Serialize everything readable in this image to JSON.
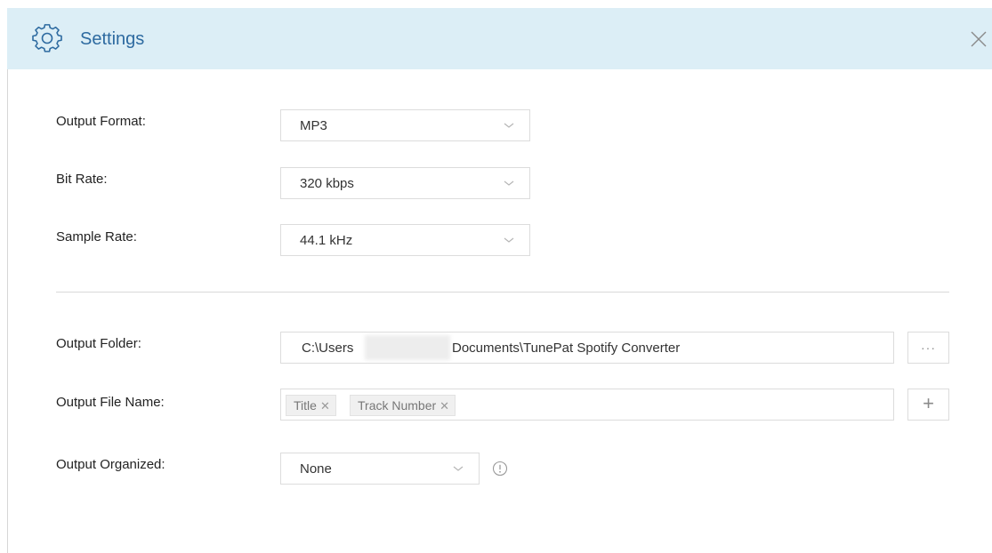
{
  "header": {
    "title": "Settings"
  },
  "settings": {
    "output_format": {
      "label": "Output Format:",
      "value": "MP3"
    },
    "bit_rate": {
      "label": "Bit Rate:",
      "value": "320 kbps"
    },
    "sample_rate": {
      "label": "Sample Rate:",
      "value": "44.1 kHz"
    },
    "output_folder": {
      "label": "Output Folder:",
      "value_prefix": "C:\\Users",
      "value_suffix": "Documents\\TunePat Spotify Converter",
      "browse_label": "···"
    },
    "output_file_name": {
      "label": "Output File Name:",
      "tags": [
        "Title",
        "Track Number"
      ],
      "add_label": "+"
    },
    "output_organized": {
      "label": "Output Organized:",
      "value": "None"
    }
  },
  "icons": {
    "header": "gear-icon",
    "close": "close-icon",
    "dropdown": "chevron-down-icon",
    "info": "info-icon",
    "tag_remove": "close-icon"
  },
  "colors": {
    "header_bg": "#dceef6",
    "accent": "#2d6aa0",
    "border": "#dcdcdc"
  }
}
